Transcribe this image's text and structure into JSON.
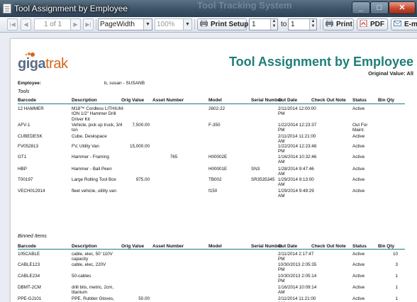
{
  "window": {
    "title": "Tool Assignment by Employee",
    "bg_title": "Tool Tracking System",
    "min": "_",
    "max": "□",
    "close": "✕"
  },
  "toolbar": {
    "first_icon": "first-page-icon",
    "prev_icon": "prev-page-icon",
    "page_info": "1 of 1",
    "next_icon": "next-page-icon",
    "last_icon": "last-page-icon",
    "zoom_mode": "PageWidth",
    "zoom_percent": "100%",
    "print_setup": "Print Setup",
    "from_page": "1",
    "to_label": "to",
    "to_page": "1",
    "print": "Print",
    "pdf": "PDF",
    "email": "E-m"
  },
  "report": {
    "logo_a": "giga",
    "logo_b": "trak",
    "title": "Tool Assignment by Employee",
    "original_value": "Original Value:  All",
    "employee_label": "Employee:",
    "employee_value": "b, susan - SUSANB",
    "columns": [
      "Barcode",
      "Description",
      "Orig Value",
      "Asset Number",
      "Model",
      "Serial Number",
      "Out Date",
      "Check Out Note",
      "Status",
      "Bin Qty"
    ],
    "tools_section": "Tools",
    "tools": [
      {
        "barcode": "12 HAMMER",
        "description": "M18™ Cordless LITHIUM-ION 1/2\" Hammer Drill Driver Kit",
        "orig_value": "",
        "asset": "",
        "model": "2602-22",
        "serial": "",
        "out_date": "2/11/2014 12:00:00 PM",
        "note": "",
        "status": "Active",
        "qty": ""
      },
      {
        "barcode": "AFV-1",
        "description": "Vehicle, pick up truck, 3/4 ton",
        "orig_value": "7,500.00",
        "asset": "",
        "model": "F-350",
        "serial": "",
        "out_date": "1/22/2014 12:23:37 PM",
        "note": "",
        "status": "Out For Maint.",
        "qty": ""
      },
      {
        "barcode": "CUBEDESK",
        "description": "Cube, Deskspace",
        "orig_value": "",
        "asset": "",
        "model": "",
        "serial": "",
        "out_date": "2/11/2014 11:21:00 AM",
        "note": "",
        "status": "Active",
        "qty": ""
      },
      {
        "barcode": "FV052813",
        "description": "FV, Utility Van",
        "orig_value": "15,000.00",
        "asset": "",
        "model": "",
        "serial": "",
        "out_date": "1/22/2014 12:23:48 PM",
        "note": "",
        "status": "Active",
        "qty": ""
      },
      {
        "barcode": "GT1",
        "description": "Hammer - Framing",
        "orig_value": "",
        "asset": "765",
        "model": "H00002E",
        "serial": "",
        "out_date": "1/16/2014 10:32:46 AM",
        "note": "",
        "status": "Active",
        "qty": ""
      },
      {
        "barcode": "HBP",
        "description": "Hammer - Ball Peen",
        "orig_value": "",
        "asset": "",
        "model": "H00001E",
        "serial": "SN3",
        "out_date": "1/28/2014 9:47:46 AM",
        "note": "",
        "status": "Active",
        "qty": ""
      },
      {
        "barcode": "T00197",
        "description": "Large Rolling Tool Box",
        "orig_value": "975.00",
        "asset": "",
        "model": "TB002",
        "serial": "SR3535345",
        "out_date": "1/29/2014 9:13:00 AM",
        "note": "",
        "status": "Active",
        "qty": ""
      },
      {
        "barcode": "VECH012914",
        "description": "fleet vehicle, utility van",
        "orig_value": "",
        "asset": "",
        "model": "f150",
        "serial": "",
        "out_date": "1/29/2014 9:49:29 AM",
        "note": "",
        "status": "Active",
        "qty": ""
      }
    ],
    "binned_section": "Binned Items",
    "binned": [
      {
        "barcode": "105CABLE",
        "description": "cable, elec, 50' 110V capacity",
        "orig_value": "",
        "asset": "",
        "model": "",
        "serial": "",
        "out_date": "2/11/2014 2:17:47 PM",
        "note": "",
        "status": "Active",
        "qty": "10"
      },
      {
        "barcode": "CABLE123",
        "description": "cable, elec, 220V",
        "orig_value": "",
        "asset": "",
        "model": "",
        "serial": "",
        "out_date": "10/30/2013 2:05:35 PM",
        "note": "",
        "status": "Active",
        "qty": "3"
      },
      {
        "barcode": "CABLE234",
        "description": "50-cables",
        "orig_value": "",
        "asset": "",
        "model": "",
        "serial": "",
        "out_date": "10/30/2013 2:05:14 PM",
        "note": "",
        "status": "Active",
        "qty": "1"
      },
      {
        "barcode": "DBMT-2CM",
        "description": "drill bits, metric, 2cm, titanium",
        "orig_value": "",
        "asset": "",
        "model": "",
        "serial": "",
        "out_date": "1/16/2014 10:09:14 AM",
        "note": "",
        "status": "Active",
        "qty": "1"
      },
      {
        "barcode": "PPE-GJ101",
        "description": "PPE, Rubber Gloves, janitorial",
        "orig_value": "50.00",
        "asset": "",
        "model": "",
        "serial": "",
        "out_date": "2/11/2014 11:21:00 AM",
        "note": "",
        "status": "Active",
        "qty": "1"
      }
    ]
  }
}
